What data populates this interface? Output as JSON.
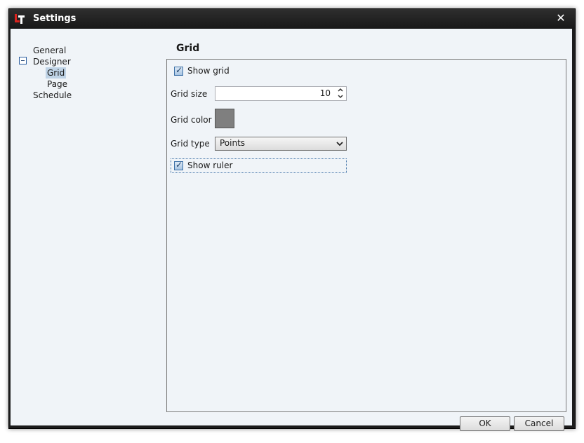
{
  "window": {
    "title": "Settings",
    "close_glyph": "✕",
    "app_icon": "lt-app-icon"
  },
  "tree": {
    "items": [
      {
        "label": "General"
      },
      {
        "label": "Designer",
        "expanded": true
      },
      {
        "label": "Grid",
        "selected": true
      },
      {
        "label": "Page"
      },
      {
        "label": "Schedule"
      }
    ]
  },
  "section": {
    "title": "Grid"
  },
  "form": {
    "show_grid_label": "Show grid",
    "show_grid_checked": true,
    "grid_size_label": "Grid size",
    "grid_size_value": "10",
    "grid_color_label": "Grid color",
    "grid_color_value": "#7f7f7f",
    "grid_type_label": "Grid type",
    "grid_type_value": "Points",
    "show_ruler_label": "Show ruler",
    "show_ruler_checked": true
  },
  "buttons": {
    "ok": "OK",
    "cancel": "Cancel"
  }
}
